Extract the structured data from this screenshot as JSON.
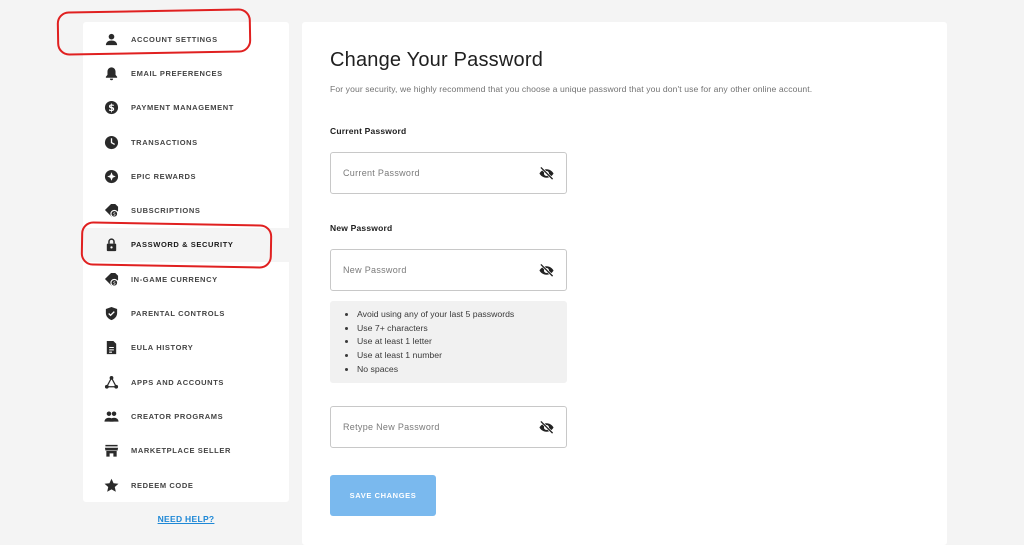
{
  "sidebar": {
    "items": [
      {
        "label": "ACCOUNT SETTINGS",
        "icon": "person-icon"
      },
      {
        "label": "EMAIL PREFERENCES",
        "icon": "bell-icon"
      },
      {
        "label": "PAYMENT MANAGEMENT",
        "icon": "dollar-icon"
      },
      {
        "label": "TRANSACTIONS",
        "icon": "clock-icon"
      },
      {
        "label": "EPIC REWARDS",
        "icon": "rewards-icon"
      },
      {
        "label": "SUBSCRIPTIONS",
        "icon": "tag-icon"
      },
      {
        "label": "PASSWORD & SECURITY",
        "icon": "lock-icon",
        "active": true
      },
      {
        "label": "IN-GAME CURRENCY",
        "icon": "currency-tag-icon"
      },
      {
        "label": "PARENTAL CONTROLS",
        "icon": "shield-icon"
      },
      {
        "label": "EULA HISTORY",
        "icon": "document-icon"
      },
      {
        "label": "APPS AND ACCOUNTS",
        "icon": "nodes-icon"
      },
      {
        "label": "CREATOR PROGRAMS",
        "icon": "people-icon"
      },
      {
        "label": "MARKETPLACE SELLER",
        "icon": "store-icon"
      },
      {
        "label": "REDEEM CODE",
        "icon": "star-icon"
      }
    ],
    "help_link": "NEED HELP?"
  },
  "main": {
    "title": "Change Your Password",
    "subtitle": "For your security, we highly recommend that you choose a unique password that you don't use for any other online account.",
    "current_password": {
      "label": "Current Password",
      "placeholder": "Current Password"
    },
    "new_password": {
      "label": "New Password",
      "placeholder": "New Password"
    },
    "rules": [
      "Avoid using any of your last 5 passwords",
      "Use 7+ characters",
      "Use at least 1 letter",
      "Use at least 1 number",
      "No spaces"
    ],
    "retype_password": {
      "placeholder": "Retype New Password"
    },
    "save_label": "SAVE CHANGES"
  },
  "colors": {
    "accent": "#7ab9ee",
    "link": "#1e88d6",
    "annotation": "#e02020"
  }
}
